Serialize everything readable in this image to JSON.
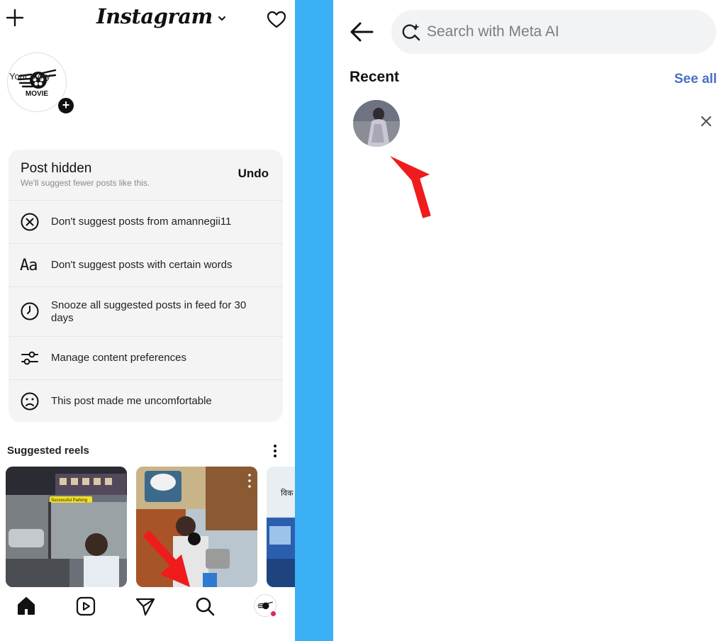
{
  "left_screen": {
    "app_name": "Instagram",
    "story": {
      "logo_text": "MOVIE",
      "label": "Your story",
      "add_symbol": "+"
    },
    "hidden_card": {
      "title": "Post hidden",
      "subtitle": "We'll suggest fewer posts like this.",
      "undo_label": "Undo",
      "options": [
        {
          "icon": "x-circle-icon",
          "label": "Don't suggest posts from amannegii11"
        },
        {
          "icon": "text-aa-icon",
          "glyph": "Aa",
          "label": "Don't suggest posts with certain words"
        },
        {
          "icon": "clock-icon",
          "label": "Snooze all suggested posts in feed for 30 days"
        },
        {
          "icon": "sliders-icon",
          "label": "Manage content preferences"
        },
        {
          "icon": "sad-face-icon",
          "label": "This post made me uncomfortable"
        }
      ]
    },
    "suggested_reels": {
      "title": "Suggested reels",
      "reel_overlay_text": "Successful Parking",
      "third_reel_text": "विक"
    },
    "bottom_nav": {
      "items": [
        "home-icon",
        "reels-icon",
        "direct-icon",
        "search-icon",
        "profile-avatar"
      ],
      "avatar_text": "MOVIE"
    }
  },
  "right_screen": {
    "search": {
      "placeholder": "Search with Meta AI",
      "value": ""
    },
    "recent": {
      "title": "Recent",
      "see_all": "See all",
      "remove_symbol": "×"
    }
  },
  "colors": {
    "divider": "#3bb0f5",
    "link_blue": "#4a6fc4",
    "arrow_red": "#ee1c1c",
    "card_bg": "#f4f4f5",
    "notification_dot": "#e0245e"
  }
}
